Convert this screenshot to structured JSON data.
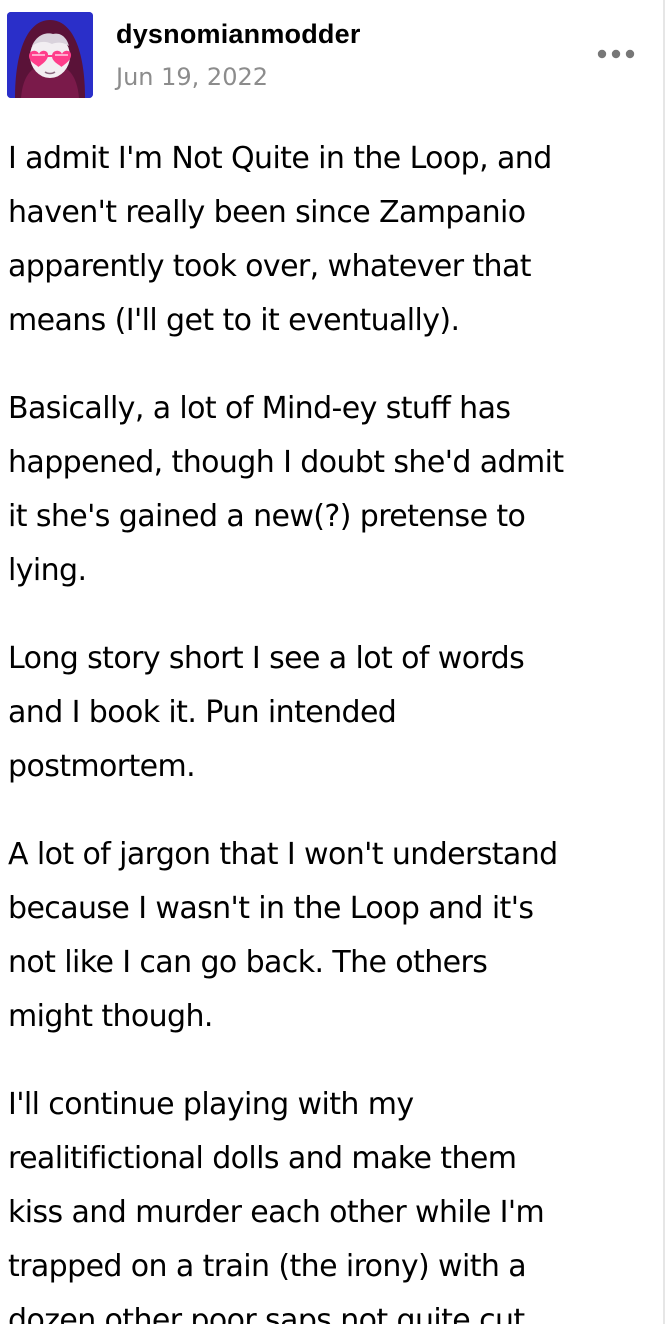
{
  "post": {
    "author": "dysnomianmodder",
    "date": "Jun 19, 2022",
    "avatar_icon": "masked-figure-heart-glasses-avatar",
    "menu_icon": "more-horizontal-icon",
    "paragraphs": [
      "I admit I'm Not Quite in the Loop, and\nhaven't really been since Zampanio\napparently took over, whatever that\nmeans (I'll get to it eventually).",
      "Basically, a lot of Mind-ey stuff has\nhappened, though I doubt she'd admit\nit she's gained a new(?) pretense to\nlying.",
      "Long story short I see a lot of words\nand I book it. Pun intended\npostmortem.",
      "A lot of jargon that I won't understand\nbecause I wasn't in the Loop and it's\nnot like I can go back. The others\nmight though.",
      "I'll continue playing with my\nrealitifictional dolls and make them\nkiss and murder each other while I'm\ntrapped on a train (the irony) with a\ndozen other poor saps not quite cut"
    ]
  },
  "colors": {
    "text": "#000000",
    "muted": "#8c8c8c",
    "avatar_bg": "#2a2fc9",
    "hood": "#5a1238",
    "glasses": "#ff3d8b"
  }
}
